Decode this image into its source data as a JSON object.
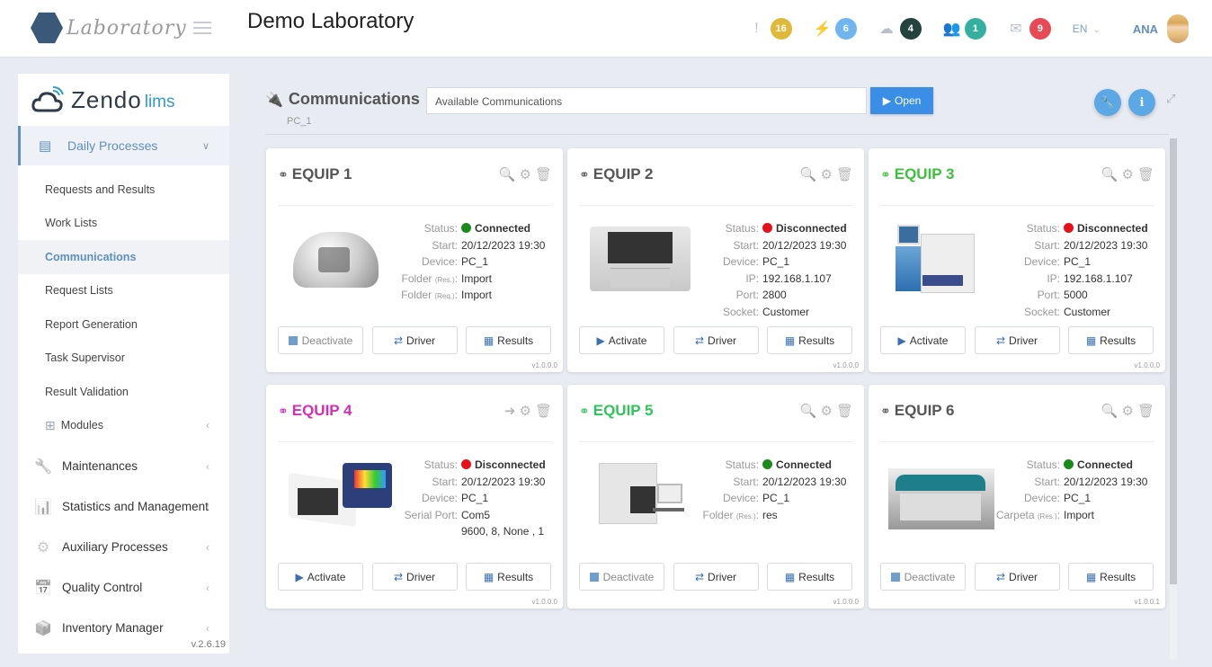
{
  "header": {
    "brand": "Laboratory",
    "app_title": "Demo Laboratory",
    "notifications": [
      {
        "icon": "exclamation-icon",
        "glyph": "!",
        "count": "16",
        "color": "#e0b83a"
      },
      {
        "icon": "plug-icon",
        "glyph": "⚡",
        "count": "6",
        "color": "#6fb6f0"
      },
      {
        "icon": "cloud-upload-icon",
        "glyph": "☁",
        "count": "4",
        "color": "#25423f"
      },
      {
        "icon": "users-icon",
        "glyph": "👥",
        "count": "1",
        "color": "#35b0a0"
      },
      {
        "icon": "envelope-open-icon",
        "glyph": "✉",
        "count": "9",
        "color": "#e84a55"
      }
    ],
    "language": "EN",
    "user": "ANA"
  },
  "sidebar": {
    "logo_main": "Zendo",
    "logo_sub": "lims",
    "group": {
      "label": "Daily Processes",
      "icon": "newspaper-icon"
    },
    "sub_items": [
      {
        "label": "Requests and Results"
      },
      {
        "label": "Work Lists"
      },
      {
        "label": "Communications",
        "active": true
      },
      {
        "label": "Request Lists"
      },
      {
        "label": "Report Generation"
      },
      {
        "label": "Task Supervisor"
      },
      {
        "label": "Result Validation"
      }
    ],
    "modules": {
      "label": "Modules",
      "icon": "grid-icon"
    },
    "main_items": [
      {
        "label": "Maintenances",
        "icon": "wrench-icon"
      },
      {
        "label": "Statistics and Management",
        "icon": "bar-chart-icon"
      },
      {
        "label": "Auxiliary Processes",
        "icon": "gear-icon"
      },
      {
        "label": "Quality Control",
        "icon": "calendar-check-icon"
      },
      {
        "label": "Inventory Manager",
        "icon": "box-icon"
      }
    ],
    "version": "v.2.6.19"
  },
  "page": {
    "title": "Communications",
    "subtitle": "PC_1",
    "select_value": "Available Communications",
    "open_label": "Open"
  },
  "equipment": [
    {
      "name": "EQUIP 1",
      "name_color": "#555555",
      "tool": "search",
      "rows": [
        {
          "label": "Status:",
          "value": "Connected",
          "status": "connected"
        },
        {
          "label": "Start:",
          "value": "20/12/2023 19:30"
        },
        {
          "label": "Device:",
          "value": "PC_1"
        },
        {
          "label": "Folder",
          "small": "(Res.)",
          "value": "Import"
        },
        {
          "label": "Folder",
          "small": "(Req.)",
          "value": "Import"
        }
      ],
      "buttons": [
        "Deactivate",
        "Driver",
        "Results"
      ],
      "active": true,
      "version": "v1.0.0.0"
    },
    {
      "name": "EQUIP 2",
      "name_color": "#555555",
      "tool": "search",
      "rows": [
        {
          "label": "Status:",
          "value": "Disconnected",
          "status": "disconnected"
        },
        {
          "label": "Start:",
          "value": "20/12/2023 19:30"
        },
        {
          "label": "Device:",
          "value": "PC_1"
        },
        {
          "label": "IP:",
          "value": "192.168.1.107"
        },
        {
          "label": "Port:",
          "value": "2800"
        },
        {
          "label": "Socket:",
          "value": "Customer"
        }
      ],
      "buttons": [
        "Activate",
        "Driver",
        "Results"
      ],
      "active": false,
      "version": "v1.0.0.0"
    },
    {
      "name": "EQUIP 3",
      "name_color": "#3cc13c",
      "tool": "search",
      "rows": [
        {
          "label": "Status:",
          "value": "Disconnected",
          "status": "disconnected"
        },
        {
          "label": "Start:",
          "value": "20/12/2023 19:30"
        },
        {
          "label": "Device:",
          "value": "PC_1"
        },
        {
          "label": "IP:",
          "value": "192.168.1.107"
        },
        {
          "label": "Port:",
          "value": "5000"
        },
        {
          "label": "Socket:",
          "value": "Customer"
        }
      ],
      "buttons": [
        "Activate",
        "Driver",
        "Results"
      ],
      "active": false,
      "version": "v1.0.0.0"
    },
    {
      "name": "EQUIP 4",
      "name_color": "#d12fb5",
      "tool": "arrow",
      "rows": [
        {
          "label": "Status:",
          "value": "Disconnected",
          "status": "disconnected"
        },
        {
          "label": "Start:",
          "value": "20/12/2023 19:30"
        },
        {
          "label": "Device:",
          "value": "PC_1"
        },
        {
          "label": "Serial Port:",
          "value": "Com5"
        },
        {
          "label": "",
          "value": "9600, 8, None , 1"
        }
      ],
      "buttons": [
        "Activate",
        "Driver",
        "Results"
      ],
      "active": false,
      "version": "v1.0.0.0"
    },
    {
      "name": "EQUIP 5",
      "name_color": "#2fc45a",
      "tool": "search",
      "rows": [
        {
          "label": "Status:",
          "value": "Connected",
          "status": "connected"
        },
        {
          "label": "Start:",
          "value": "20/12/2023 19:30"
        },
        {
          "label": "Device:",
          "value": "PC_1"
        },
        {
          "label": "Folder",
          "small": "(Res.)",
          "value": "res"
        }
      ],
      "buttons": [
        "Deactivate",
        "Driver",
        "Results"
      ],
      "active": true,
      "dim": true,
      "version": "v1.0.0.0"
    },
    {
      "name": "EQUIP 6",
      "name_color": "#555555",
      "tool": "search",
      "rows": [
        {
          "label": "Status:",
          "value": "Connected",
          "status": "connected"
        },
        {
          "label": "Start:",
          "value": "20/12/2023 19:30"
        },
        {
          "label": "Device:",
          "value": "PC_1"
        },
        {
          "label": "Carpeta",
          "small": "(Res.)",
          "value": "Import"
        }
      ],
      "buttons": [
        "Deactivate",
        "Driver",
        "Results"
      ],
      "active": true,
      "dim": true,
      "version": "v1.0.0.1"
    }
  ],
  "colors": {
    "connected": "#1a8a1a",
    "disconnected": "#e8101a",
    "accent": "#5e8fc0",
    "open_button": "#3a8ee6"
  }
}
